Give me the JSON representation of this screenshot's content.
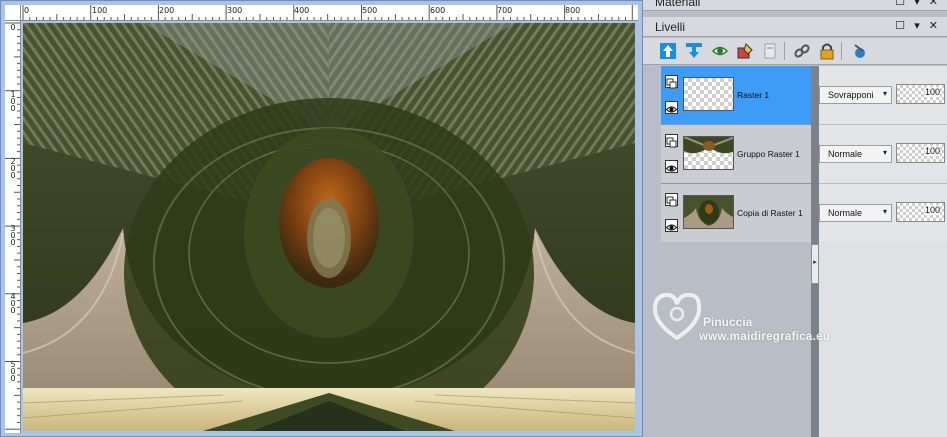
{
  "rulers": {
    "top": [
      "0",
      "100",
      "200",
      "300",
      "400",
      "500",
      "600",
      "700",
      "800"
    ],
    "left": [
      "0",
      "100",
      "200",
      "300",
      "400",
      "500"
    ]
  },
  "panels": {
    "materials_title": "Materiali",
    "layers_title": "Livelli",
    "header_buttons": "☐ ▾ ✕"
  },
  "toolbar": {
    "icons": [
      "move-layer-up-icon",
      "move-layer-down-icon",
      "layer-visibility-icon",
      "edit-layer-icon",
      "new-layer-icon",
      "link-layer-icon",
      "lock-layer-icon",
      "delete-layer-icon"
    ]
  },
  "layers": [
    {
      "name": "Raster 1",
      "blend_mode": "Sovrapponi",
      "opacity": "100",
      "selected": true
    },
    {
      "name": "Gruppo Raster 1",
      "blend_mode": "Normale",
      "opacity": "100",
      "selected": false
    },
    {
      "name": "Copia di Raster 1",
      "blend_mode": "Normale",
      "opacity": "100",
      "selected": false
    }
  ],
  "dropdown_caret": "▾",
  "scroll_handle_glyph": "▸",
  "watermark": {
    "name": "Pinuccia",
    "url": "www.maidiregrafica.eu"
  },
  "colors": {
    "selection": "#3c9cf8",
    "canvas_dark": "#3a4222",
    "canvas_sand": "#aa9a86"
  }
}
